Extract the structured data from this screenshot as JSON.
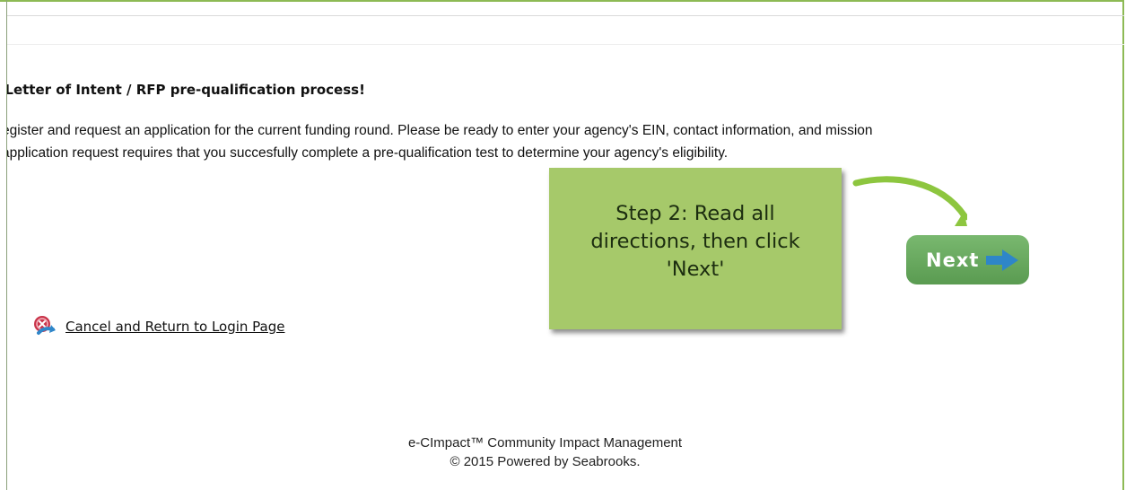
{
  "page": {
    "heading": "e Letter of Intent / RFP pre-qualification process!",
    "paragraph_lines": [
      "egister and request an application for the current funding round. Please be ready to enter your agency's EIN, contact information, and mission",
      "application request requires that you succesfully complete a pre-qualification test to determine your agency's eligibility."
    ]
  },
  "callout": {
    "text": "Step 2: Read all directions, then click 'Next'",
    "background": "#a6c96a"
  },
  "next_button": {
    "label": "Next",
    "icon": "right-arrow-icon"
  },
  "cancel_link": {
    "label": "Cancel and Return to Login Page",
    "icon": "cancel-return-icon"
  },
  "footer": {
    "line1": "e-CImpact™ Community Impact Management",
    "line2": "© 2015 Powered by Seabrooks."
  },
  "colors": {
    "frame_border": "#8dba55",
    "next_button": "#6aab60",
    "arrow": "#8dc63f"
  }
}
